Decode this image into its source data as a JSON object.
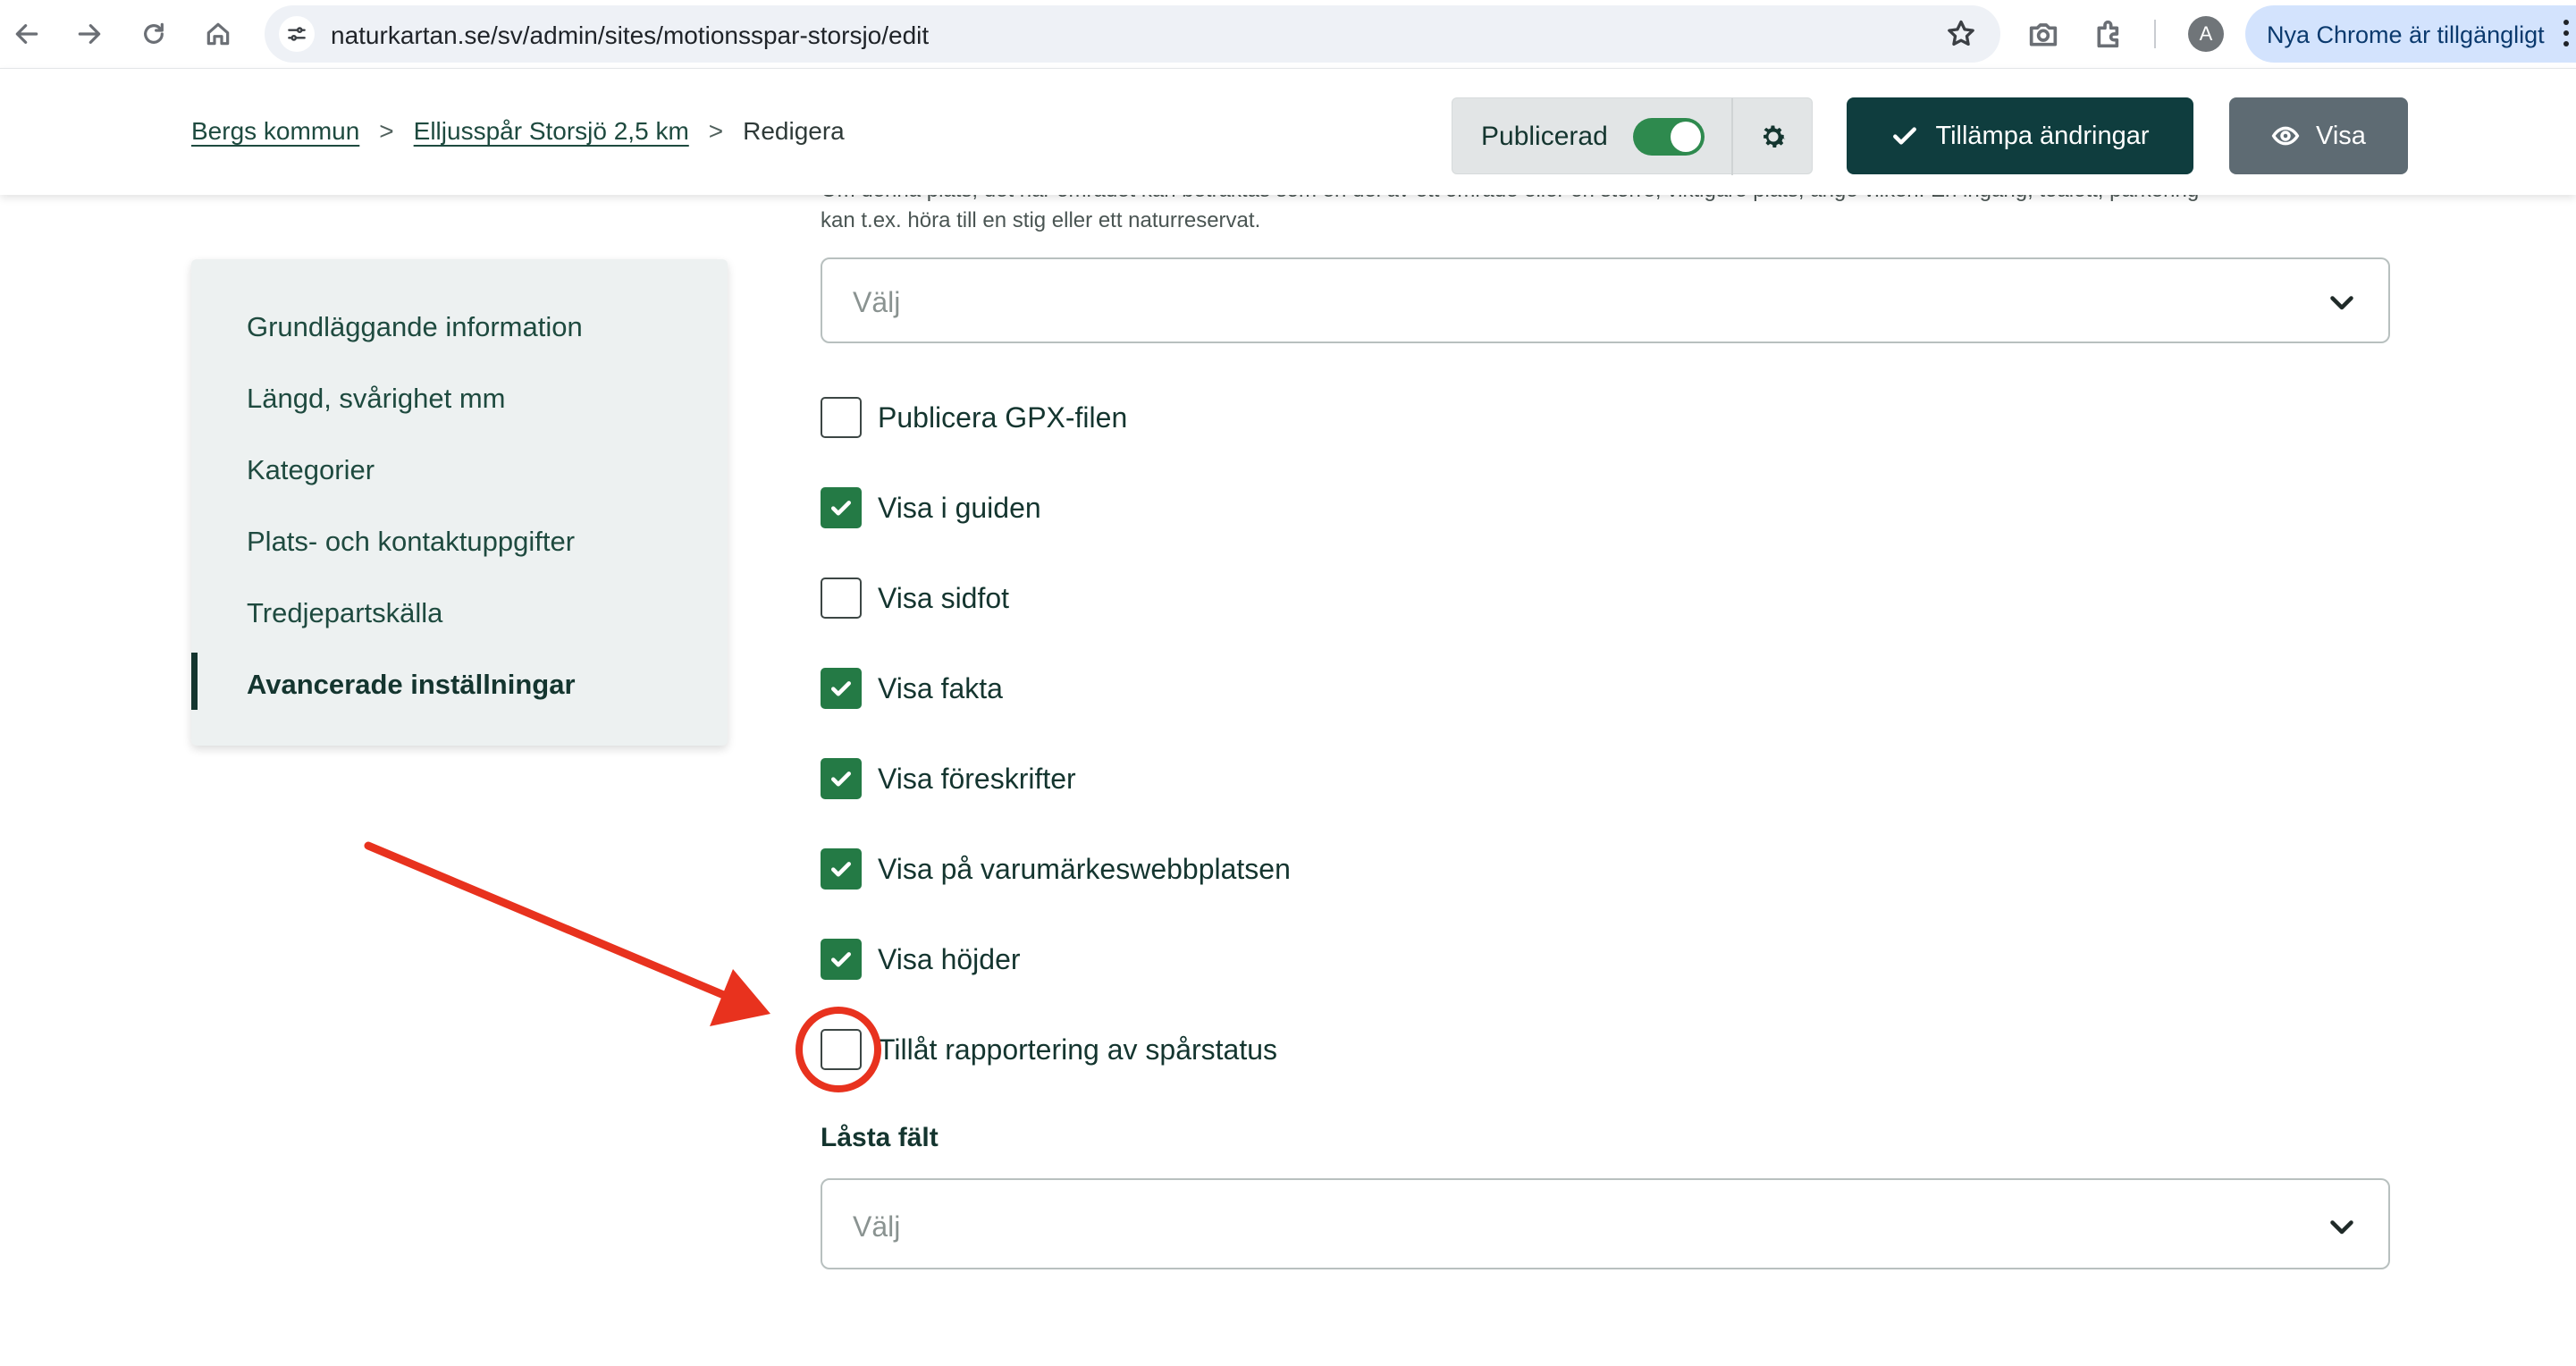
{
  "browser": {
    "url": "naturkartan.se/sv/admin/sites/motionsspar-storsjo/edit",
    "avatar_initial": "A",
    "update_notice": "Nya Chrome är tillgängligt"
  },
  "header": {
    "breadcrumb": [
      {
        "label": "Bergs kommun"
      },
      {
        "label": "Elljusspår Storsjö 2,5 km"
      },
      {
        "label": "Redigera"
      }
    ],
    "breadcrumb_separator": ">",
    "publish_label": "Publicerad",
    "publish_on": true,
    "apply_label": "Tillämpa ändringar",
    "view_label": "Visa"
  },
  "sidebar": {
    "items": [
      {
        "label": "Grundläggande information",
        "active": false
      },
      {
        "label": "Längd, svårighet mm",
        "active": false
      },
      {
        "label": "Kategorier",
        "active": false
      },
      {
        "label": "Plats- och kontaktuppgifter",
        "active": false
      },
      {
        "label": "Tredjepartskälla",
        "active": false
      },
      {
        "label": "Avancerade inställningar",
        "active": true
      }
    ]
  },
  "main": {
    "help_line1": "Om denna plats, det här området kan betraktas som en del av ett område eller en större, viktigare plats, ange vilken. En ingång, toalett, parkering",
    "help_line2": "kan t.ex. höra till en stig eller ett naturreservat.",
    "parent_select_placeholder": "Välj",
    "checkboxes": [
      {
        "label": "Publicera GPX-filen",
        "checked": false
      },
      {
        "label": "Visa i guiden",
        "checked": true
      },
      {
        "label": "Visa sidfot",
        "checked": false
      },
      {
        "label": "Visa fakta",
        "checked": true
      },
      {
        "label": "Visa föreskrifter",
        "checked": true
      },
      {
        "label": "Visa på varumärkeswebbplatsen",
        "checked": true
      },
      {
        "label": "Visa höjder",
        "checked": true
      },
      {
        "label": "Tillåt rapportering av spårstatus",
        "checked": false
      }
    ],
    "locked_fields_label": "Låsta fält",
    "locked_fields_placeholder": "Välj"
  },
  "colors": {
    "brand_dark": "#0f3d3e",
    "check_green": "#247a45",
    "toggle_green": "#2e8a4e",
    "annotation_red": "#e8321e"
  },
  "icons": [
    "back-icon",
    "forward-icon",
    "reload-icon",
    "home-icon",
    "site-settings-icon",
    "bookmark-star-icon",
    "camera-icon",
    "extensions-icon",
    "gear-icon",
    "check-icon",
    "eye-icon",
    "chevron-down-icon"
  ]
}
